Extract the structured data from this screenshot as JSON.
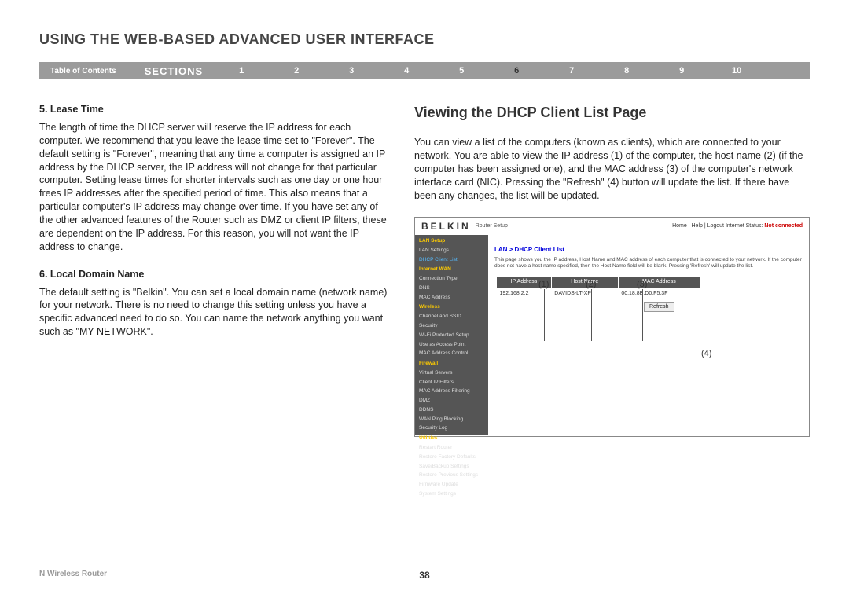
{
  "header": {
    "title": "USING THE WEB-BASED ADVANCED USER INTERFACE"
  },
  "navbar": {
    "toc": "Table of Contents",
    "sections_label": "SECTIONS",
    "items": [
      "1",
      "2",
      "3",
      "4",
      "5",
      "6",
      "7",
      "8",
      "9",
      "10"
    ],
    "active_index": 5
  },
  "left_column": {
    "sec5_title": "5.   Lease Time",
    "sec5_body": "The length of time the DHCP server will reserve the IP address for each computer. We recommend that you leave the lease time set to \"Forever\". The default setting is \"Forever\", meaning that any time a computer is assigned an IP address by the DHCP server, the IP address will not change for that particular computer. Setting lease times for shorter intervals such as one day or one hour frees IP addresses after the specified period of time. This also means that a particular computer's IP address may change over time. If you have set any of the other advanced features of the Router such as DMZ or client IP filters, these are dependent on the IP address. For this reason, you will not want the IP address to change.",
    "sec6_title": "6.   Local Domain Name",
    "sec6_body": "The default setting is \"Belkin\". You can set a local domain name (network name) for your network. There is no need to change this setting unless you have a specific advanced need to do so. You can name the network anything you want such as \"MY NETWORK\"."
  },
  "right_column": {
    "title": "Viewing the DHCP Client List Page",
    "body": "You can view a list of the computers (known as clients), which are connected to your network. You are able to view the IP address (1) of the computer, the host name (2) (if the computer has been assigned one), and the MAC address (3) of the computer's network interface card (NIC). Pressing the \"Refresh\" (4) button will update the list. If there have been any changes, the list will be updated."
  },
  "screenshot": {
    "logo": "BELKIN",
    "logo_sub": "Router Setup",
    "top_links": "Home | Help | Logout   Internet Status:",
    "top_status": "Not connected",
    "sidebar": {
      "groups": [
        {
          "header": "LAN Setup",
          "items": [
            "LAN Settings",
            "DHCP Client List"
          ],
          "active": 1
        },
        {
          "header": "Internet WAN",
          "items": [
            "Connection Type",
            "DNS",
            "MAC Address"
          ]
        },
        {
          "header": "Wireless",
          "items": [
            "Channel and SSID",
            "Security",
            "Wi-Fi Protected Setup",
            "Use as Access Point",
            "MAC Address Control"
          ]
        },
        {
          "header": "Firewall",
          "items": [
            "Virtual Servers",
            "Client IP Filters",
            "MAC Address Filtering",
            "DMZ",
            "DDNS",
            "WAN Ping Blocking",
            "Security Log"
          ]
        },
        {
          "header": "Utilities",
          "items": [
            "Restart Router",
            "Restore Factory Defaults",
            "Save/Backup Settings",
            "Restore Previous Settings",
            "Firmware Update",
            "System Settings"
          ]
        }
      ]
    },
    "breadcrumb": "LAN > DHCP Client List",
    "description": "This page shows you the IP address, Host Name and MAC address of each computer that is connected to your network. If the computer does not have a host name specified, then the Host Name field will be blank. Pressing 'Refresh' will update the list.",
    "table": {
      "headers": [
        "IP Address",
        "Host Name",
        "MAC Address"
      ],
      "row": [
        "192.168.2.2",
        "DAVIDS-LT-XP",
        "00:18:8B:D0:F5:3F"
      ]
    },
    "refresh": "Refresh"
  },
  "callouts": {
    "c1": "(1)",
    "c2": "(2)",
    "c3": "(3)",
    "c4": "(4)"
  },
  "footer": {
    "left": "N Wireless Router",
    "page": "38"
  }
}
